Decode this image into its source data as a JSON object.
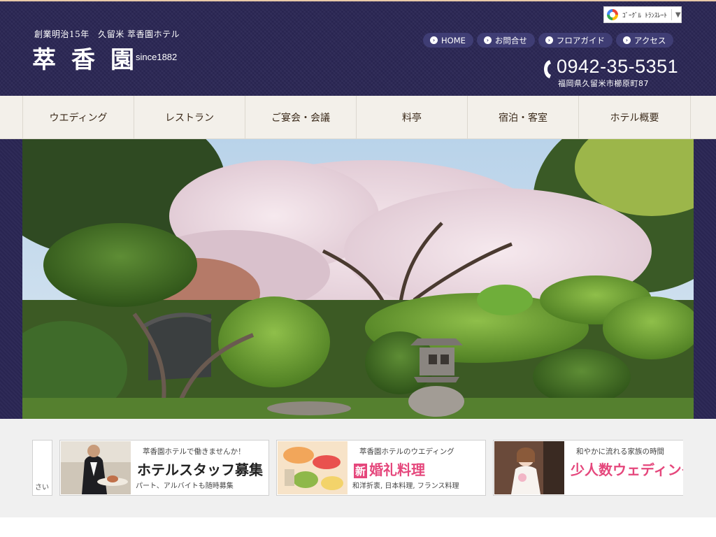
{
  "header": {
    "tagline": "創業明治15年　久留米 萃香園ホテル",
    "logo": "萃香園",
    "since": "since1882",
    "translate_label": "ｺﾞｰｸﾞﾙ ﾄﾗﾝｽﾚｰﾄ",
    "translate_arrow": "▼",
    "top_nav": [
      {
        "label": "HOME"
      },
      {
        "label": "お問合せ"
      },
      {
        "label": "フロアガイド"
      },
      {
        "label": "アクセス"
      }
    ],
    "phone": "0942-35-5351",
    "address": "福岡県久留米市櫛原町87"
  },
  "main_nav": [
    {
      "label": "ウエディング"
    },
    {
      "label": "レストラン"
    },
    {
      "label": "ご宴会・会議"
    },
    {
      "label": "料亭"
    },
    {
      "label": "宿泊・客室"
    },
    {
      "label": "ホテル概要"
    }
  ],
  "banners": {
    "partial_left_text": "さい",
    "staff": {
      "sub": "萃香園ホテルで働きませんか！",
      "main": "ホテルスタッフ募集",
      "small": "パート、アルバイトも随時募集"
    },
    "cuisine": {
      "sub": "萃香園ホテルのウエディング",
      "badge": "新",
      "main": "婚礼料理",
      "small": "和洋折衷, 日本料理, フランス料理"
    },
    "small_wedding": {
      "sub": "和やかに流れる家族の時間",
      "main": "少人数ウェディング"
    }
  },
  "colors": {
    "header_bg": "#2a2654",
    "pill_bg": "#3f3d74",
    "nav_bg": "#f3f0ea",
    "accent_pink": "#e5477c"
  }
}
